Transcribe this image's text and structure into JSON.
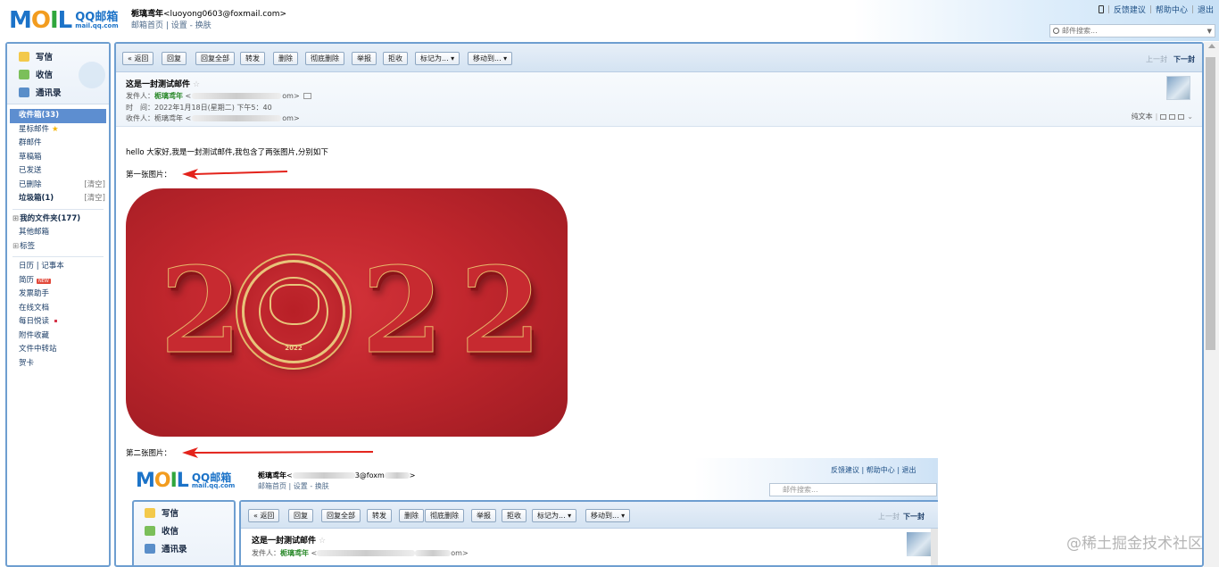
{
  "header": {
    "logo_moil": [
      "M",
      "O",
      "I",
      "L"
    ],
    "logo_qq": "QQ邮箱",
    "logo_domain": "mail.qq.com",
    "user_name": "栀璃鸢年",
    "user_email": "<luoyong0603@foxmail.com>",
    "user_links": "邮箱首页 | 设置 - 换肤",
    "top_links": [
      "反馈建议",
      "帮助中心",
      "退出"
    ],
    "search_placeholder": "邮件搜索..."
  },
  "sidebar": {
    "compose": [
      "写信",
      "收信",
      "通讯录"
    ],
    "folders": [
      {
        "label": "收件箱(33)",
        "active": true
      },
      {
        "label": "星标邮件"
      },
      {
        "label": "群邮件"
      },
      {
        "label": "草稿箱"
      },
      {
        "label": "已发送"
      },
      {
        "label": "已删除",
        "right": "[清空]"
      },
      {
        "label": "垃圾箱(1)",
        "right": "[清空]",
        "bold": true
      }
    ],
    "groups": [
      "我的文件夹(177)",
      "其他邮箱",
      "标签"
    ],
    "tools": [
      {
        "label": "日历 | 记事本"
      },
      {
        "label": "简历",
        "badge": "NEW"
      },
      {
        "label": "发票助手"
      },
      {
        "label": "在线文档"
      },
      {
        "label": "每日悦读"
      },
      {
        "label": "附件收藏"
      },
      {
        "label": "文件中转站"
      },
      {
        "label": "贺卡"
      }
    ]
  },
  "toolbar": {
    "back": "« 返回",
    "buttons": [
      "回复",
      "回复全部",
      "转发",
      "删除",
      "彻底删除",
      "举报",
      "拒收",
      "标记为... ▾",
      "移动到... ▾"
    ],
    "prev": "上一封",
    "next": "下一封"
  },
  "mail": {
    "subject": "这是一封测试邮件",
    "from_label": "发件人：",
    "from_name": "栀璃鸢年",
    "from_tail": "om>",
    "time_label": "时　间：",
    "time_value": "2022年1月18日(星期二) 下午5：40",
    "to_label": "收件人：",
    "to_name": "栀璃鸢年",
    "to_tail": "om>",
    "plain_text": "纯文本"
  },
  "body": {
    "intro": "hello 大家好,我是一封测试邮件,我包含了两张图片,分别如下",
    "first_label": "第一张图片：",
    "second_label": "第二张图片：",
    "image_year": [
      "2",
      "2",
      "2"
    ],
    "medallion_year": "2022"
  },
  "embedded": {
    "user_name": "栀璃鸢年",
    "user_tail": "3@foxm",
    "user_links": "邮箱首页 | 设置 - 换肤",
    "top_links": "反馈建议 | 帮助中心 | 退出",
    "search_placeholder": "邮件搜索...",
    "compose": [
      "写信",
      "收信",
      "通讯录"
    ],
    "back": "« 返回",
    "buttons": [
      "回复",
      "回复全部",
      "转发",
      "删除",
      "彻底删除",
      "举报",
      "拒收",
      "标记为... ▾",
      "移动到... ▾"
    ],
    "prev": "上一封",
    "next": "下一封",
    "subject": "这是一封测试邮件",
    "from_label": "发件人：",
    "from_name": "栀璃鸢年"
  },
  "watermark": "@稀土掘金技术社区"
}
